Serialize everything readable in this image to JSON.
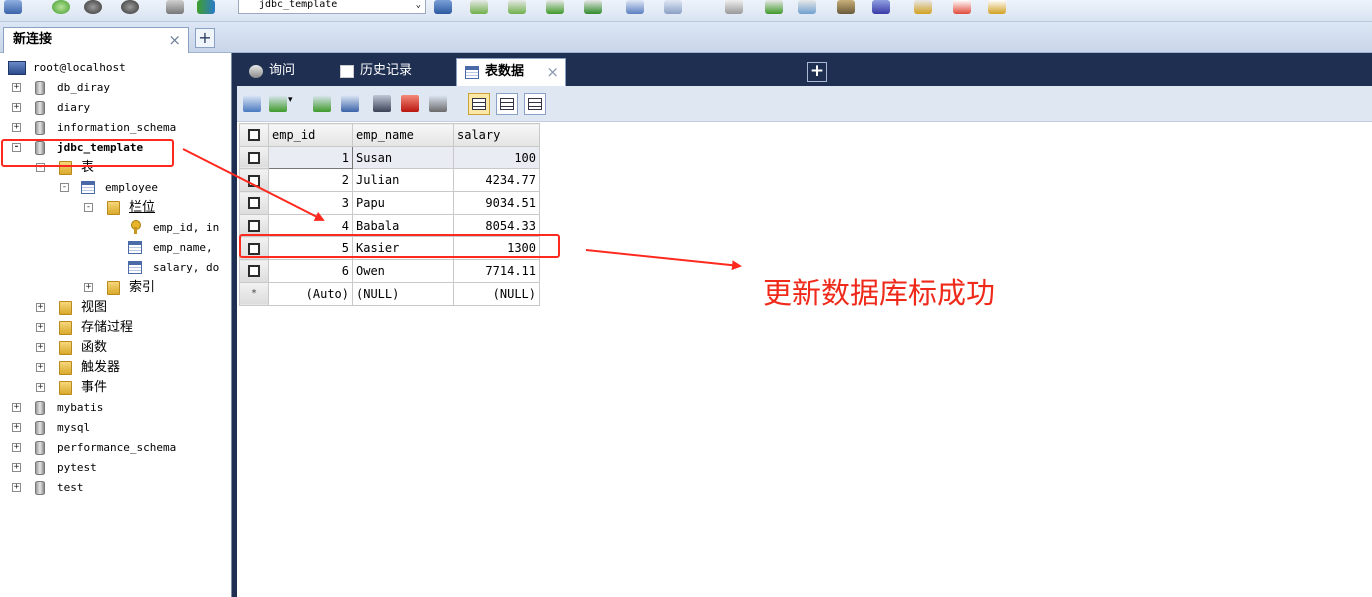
{
  "toolbar": {
    "db_selector": "jdbc_template",
    "icons": [
      "connect-icon",
      "new-db-icon",
      "stop-icon",
      "execute-icon",
      "new-query-icon",
      "refresh-icon",
      "import-icon",
      "export-icon",
      "backup-icon",
      "restore-icon",
      "schema-icon",
      "table-icon",
      "tools-icon",
      "sync-icon",
      "schedule-icon",
      "user-icon",
      "history-icon",
      "options-icon"
    ]
  },
  "connection_tab": {
    "label": "新连接",
    "close": "×",
    "add": "+"
  },
  "tree": {
    "root": "root@localhost",
    "databases": [
      {
        "name": "db_diray",
        "expander": "+"
      },
      {
        "name": "diary",
        "expander": "+"
      },
      {
        "name": "information_schema",
        "expander": "+"
      },
      {
        "name": "jdbc_template",
        "expander": "-"
      }
    ],
    "jdbc_children": {
      "tables_folder": "表",
      "table": "employee",
      "columns_folder": "栏位",
      "columns": [
        "emp_id, in",
        "emp_name,",
        "salary, do"
      ],
      "index_folder": "索引",
      "views": "视图",
      "procedures": "存储过程",
      "functions": "函数",
      "triggers": "触发器",
      "events": "事件"
    },
    "more_databases": [
      "mybatis",
      "mysql",
      "performance_schema",
      "pytest",
      "test"
    ]
  },
  "editor_tabs": [
    {
      "label": "询问"
    },
    {
      "label": "历史记录"
    },
    {
      "label": "表数据",
      "close": "×"
    }
  ],
  "editor_tab_add": "+",
  "table": {
    "columns": [
      "emp_id",
      "emp_name",
      "salary"
    ],
    "rows": [
      {
        "emp_id": "1",
        "emp_name": "Susan",
        "salary": "100"
      },
      {
        "emp_id": "2",
        "emp_name": "Julian",
        "salary": "4234.77"
      },
      {
        "emp_id": "3",
        "emp_name": "Papu",
        "salary": "9034.51"
      },
      {
        "emp_id": "4",
        "emp_name": "Babala",
        "salary": "8054.33"
      },
      {
        "emp_id": "5",
        "emp_name": "Kasier",
        "salary": "1300"
      },
      {
        "emp_id": "6",
        "emp_name": "Owen",
        "salary": "7714.11"
      }
    ],
    "new_row": {
      "marker": "*",
      "emp_id": "(Auto)",
      "emp_name": "(NULL)",
      "salary": "(NULL)"
    }
  },
  "annotation": {
    "text": "更新数据库标成功",
    "color": "#ef2a1a"
  }
}
